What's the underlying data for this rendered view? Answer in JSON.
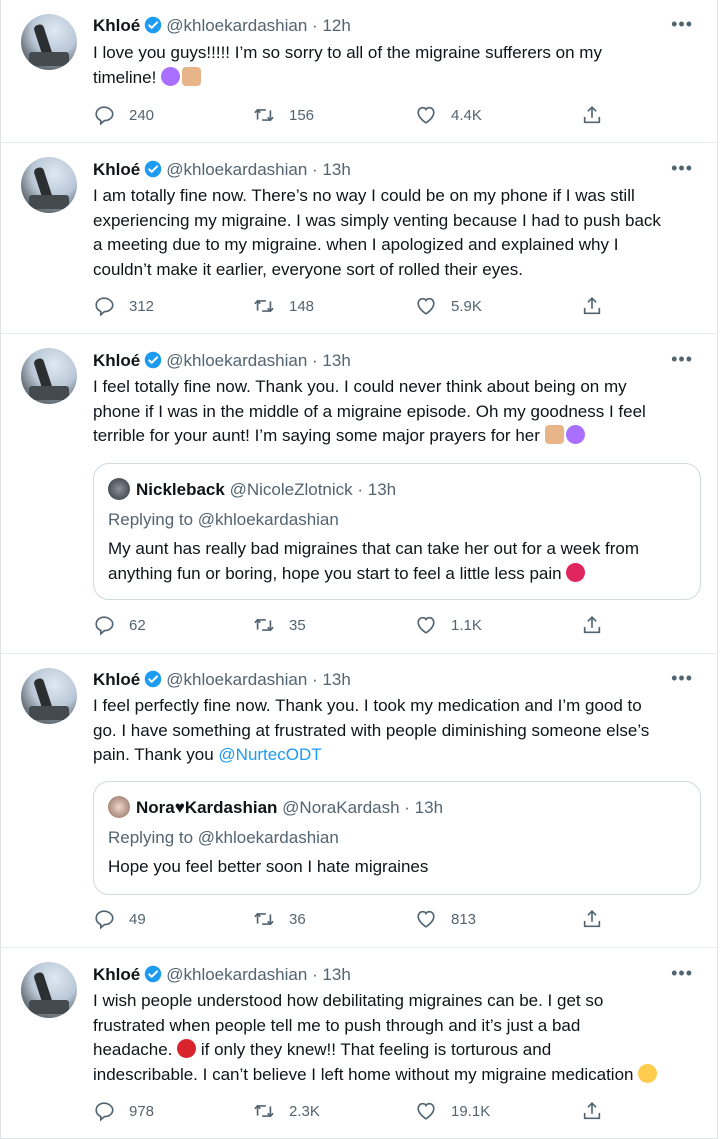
{
  "tweets": [
    {
      "name": "Khloé",
      "handle": "@khloekardashian",
      "time": "· 12h",
      "lines": [
        "I love you guys!!!!! I’m so sorry to all of the migraine sufferers on my",
        "timeline!"
      ],
      "replies": "240",
      "retweets": "156",
      "likes": "4.4K"
    },
    {
      "name": "Khloé",
      "handle": "@khloekardashian",
      "time": "· 13h",
      "lines": [
        "I am totally fine now. There’s no way I could be on my phone if I was still",
        "experiencing my migraine. I was simply venting because I had to push back",
        "a meeting due to my migraine. when I apologized and explained why I",
        "couldn’t make it earlier, everyone sort of rolled their eyes."
      ],
      "replies": "312",
      "retweets": "148",
      "likes": "5.9K"
    },
    {
      "name": "Khloé",
      "handle": "@khloekardashian",
      "time": "· 13h",
      "lines": [
        "I feel totally fine now. Thank you. I could never think about being on my",
        "phone if I was in the middle of a migraine episode. Oh my goodness I feel",
        "terrible for your aunt! I’m saying some major prayers for her"
      ],
      "quote": {
        "name": "Nickleback",
        "handle": "@NicoleZlotnick · 13h",
        "reply": "Replying to @khloekardashian",
        "lines": [
          "My aunt has really bad migraines that can take her out for a week from",
          "anything fun or boring, hope you start to feel a little less pain"
        ]
      },
      "replies": "62",
      "retweets": "35",
      "likes": "1.1K"
    },
    {
      "name": "Khloé",
      "handle": "@khloekardashian",
      "time": "· 13h",
      "lines": [
        "I feel perfectly fine now. Thank you. I took my medication and I’m good to",
        "go. I have something at frustrated with people diminishing someone else’s",
        "pain. Thank you"
      ],
      "mention": "@NurtecODT",
      "quote": {
        "name": "Nora♥Kardashian",
        "handle": "@NoraKardash · 13h",
        "reply": "Replying to @khloekardashian",
        "lines": [
          "Hope you feel better soon I hate migraines"
        ]
      },
      "replies": "49",
      "retweets": "36",
      "likes": "813"
    },
    {
      "name": "Khloé",
      "handle": "@khloekardashian",
      "time": "· 13h",
      "lines": [
        "I wish people understood how debilitating migraines can be. I get so",
        "frustrated when people tell me to push through and it’s just a bad",
        "headache.",
        "if only they knew!! That feeling is torturous and",
        "indescribable. I can’t believe I left home without my migraine medication"
      ],
      "replies": "978",
      "retweets": "2.3K",
      "likes": "19.1K"
    }
  ],
  "icons": {
    "more": "more-icon",
    "reply": "reply-icon",
    "retweet": "retweet-icon",
    "like": "heart-icon",
    "share": "share-icon",
    "verified": "verified-badge-icon"
  },
  "colors": {
    "link": "#1d9bf0",
    "muted": "#536471",
    "verified": "#1d9bf0",
    "border": "#cfd9de"
  }
}
